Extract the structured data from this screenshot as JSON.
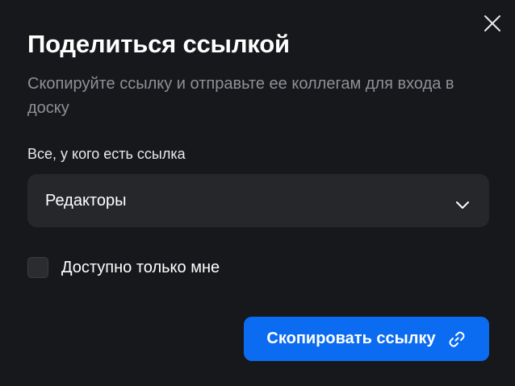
{
  "dialog": {
    "title": "Поделиться ссылкой",
    "subtitle": "Скопируйте ссылку и отправьте ее коллегам для входа в доску",
    "close_icon": "close-icon"
  },
  "access": {
    "label": "Все, у кого есть ссылка",
    "selected": "Редакторы",
    "dropdown_icon": "chevron-down-icon"
  },
  "only_me": {
    "label": "Доступно только мне",
    "checked": false
  },
  "copy_button": {
    "label": "Скопировать ссылку",
    "icon": "link-icon"
  },
  "colors": {
    "background": "#17181b",
    "field": "#26272b",
    "accent": "#0b6cf2",
    "muted_text": "#8e9096"
  }
}
